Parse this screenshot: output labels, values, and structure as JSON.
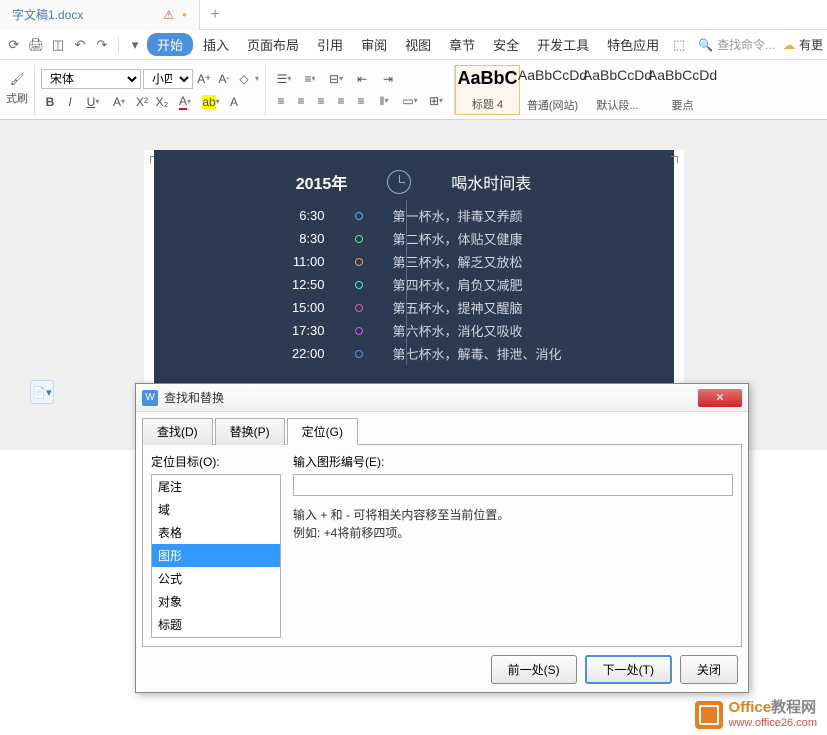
{
  "tab": {
    "name": "字文稿1.docx"
  },
  "menu": {
    "start": "开始",
    "insert": "插入",
    "layout": "页面布局",
    "ref": "引用",
    "review": "审阅",
    "view": "视图",
    "chapter": "章节",
    "safe": "安全",
    "dev": "开发工具",
    "special": "特色应用",
    "search_placeholder": "查找命令...",
    "update": "有更"
  },
  "toolbar": {
    "brush": "式刷",
    "font_name": "宋体",
    "font_size": "小四",
    "styles": [
      {
        "preview": "AaBbC",
        "label": "标题 4"
      },
      {
        "preview": "AaBbCcDd",
        "label": "普通(网站)"
      },
      {
        "preview": "AaBbCcDd",
        "label": "默认段..."
      },
      {
        "preview": "AaBbCcDd",
        "label": "要点"
      }
    ]
  },
  "schedule": {
    "year": "2015年",
    "title": "喝水时间表",
    "rows": [
      {
        "time": "6:30",
        "color": "#5bb5e8",
        "text": "第一杯水，排毒又养颜"
      },
      {
        "time": "8:30",
        "color": "#5be88c",
        "text": "第二杯水，体贴又健康"
      },
      {
        "time": "11:00",
        "color": "#e8a05b",
        "text": "第三杯水，解乏又放松"
      },
      {
        "time": "12:50",
        "color": "#5be8c0",
        "text": "第四杯水，肩负又减肥"
      },
      {
        "time": "15:00",
        "color": "#e85ba0",
        "text": "第五杯水，提神又醒脑"
      },
      {
        "time": "17:30",
        "color": "#c05be8",
        "text": "第六杯水，消化又吸收"
      },
      {
        "time": "22:00",
        "color": "#5b8ce8",
        "text": "第七杯水，解毒、排泄、消化"
      }
    ]
  },
  "dialog": {
    "title": "查找和替换",
    "tabs": {
      "find": "查找(D)",
      "replace": "替换(P)",
      "goto": "定位(G)"
    },
    "target_label": "定位目标(O):",
    "input_label": "输入图形编号(E):",
    "hint1": "输入 + 和 - 可将相关内容移至当前位置。",
    "hint2": "例如: +4将前移四项。",
    "list": [
      "尾注",
      "域",
      "表格",
      "图形",
      "公式",
      "对象",
      "标题"
    ],
    "selected": "图形",
    "btn_prev": "前一处(S)",
    "btn_next": "下一处(T)",
    "btn_close": "关闭"
  },
  "watermark": {
    "line1a": "Office",
    "line1b": "教程网",
    "line2": "www.office26.com"
  }
}
